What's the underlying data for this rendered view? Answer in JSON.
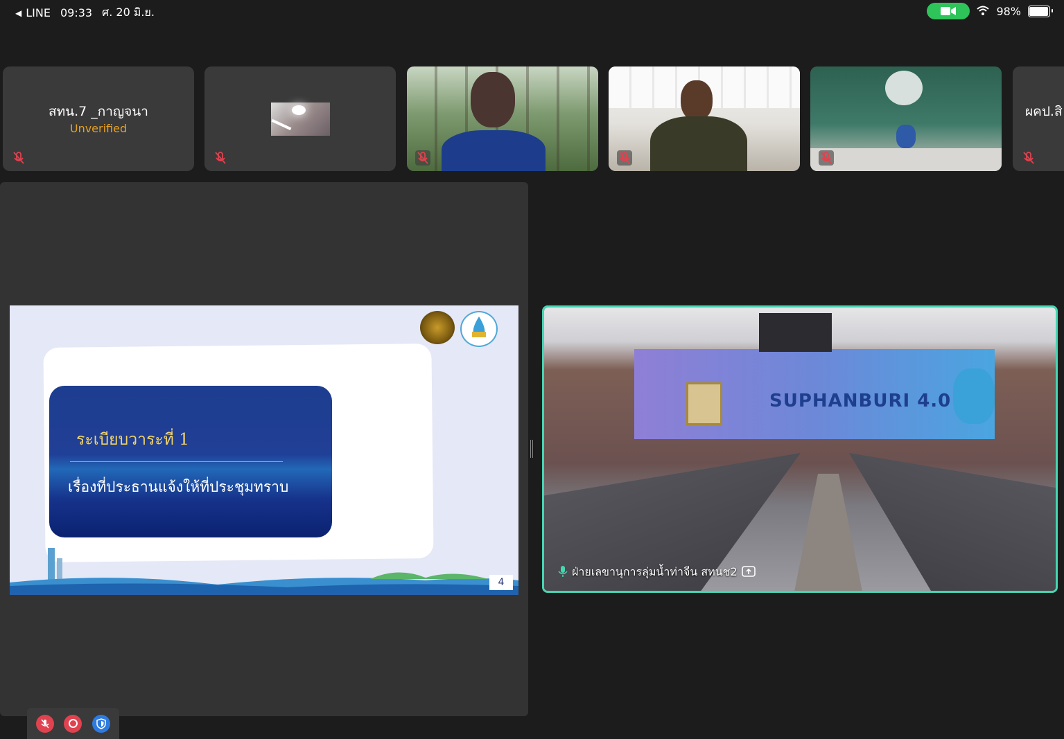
{
  "status_bar": {
    "back_app": "LINE",
    "time": "09:33",
    "date": "ศ. 20 มิ.ย.",
    "battery": "98%"
  },
  "participants": [
    {
      "name": "สทน.7 _กาญจนา",
      "status": "Unverified"
    },
    {
      "name": "",
      "status": ""
    },
    {
      "name": "",
      "status": ""
    },
    {
      "name": "",
      "status": ""
    },
    {
      "name": "",
      "status": ""
    },
    {
      "name": "ผคป.สิ",
      "status": ""
    }
  ],
  "slide": {
    "title": "ระเบียบวาระที่ 1",
    "subtitle": "เรื่องที่ประธานแจ้งให้ที่ประชุมทราบ",
    "page_number": "4"
  },
  "active_speaker": {
    "label": "ฝ่ายเลขานุการลุ่มน้ำท่าจีน สทนช2",
    "banner_text": "SUPHANBURI 4.0"
  },
  "colors": {
    "active_border": "#45d6b2",
    "unverified": "#e6a122",
    "mute_red": "#e0424f",
    "shield_blue": "#2e7be0"
  }
}
